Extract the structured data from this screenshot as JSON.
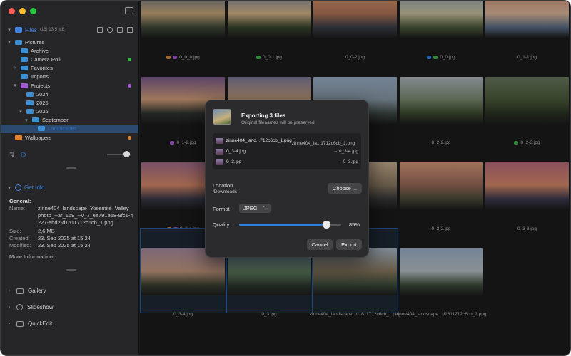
{
  "sidebar": {
    "files_title": "Files",
    "files_meta": "(16) 13,5 MB",
    "tree": [
      {
        "label": "Pictures",
        "level": 0,
        "chevron": "▾",
        "color": "#3d8fd4"
      },
      {
        "label": "Archive",
        "level": 1,
        "chevron": "",
        "color": "#3d8fd4"
      },
      {
        "label": "Camera Roll",
        "level": 1,
        "chevron": "",
        "color": "#3d8fd4",
        "dot": "#3ab54a"
      },
      {
        "label": "Favorites",
        "level": 1,
        "chevron": "›",
        "color": "#3d8fd4"
      },
      {
        "label": "Imports",
        "level": 1,
        "chevron": "",
        "color": "#3d8fd4"
      },
      {
        "label": "Projects",
        "level": 1,
        "chevron": "▾",
        "color": "#a45bd6",
        "dot": "#a45bd6"
      },
      {
        "label": "2024",
        "level": 2,
        "chevron": "",
        "color": "#3d8fd4"
      },
      {
        "label": "2025",
        "level": 2,
        "chevron": "",
        "color": "#3d8fd4"
      },
      {
        "label": "2026",
        "level": 2,
        "chevron": "▾",
        "color": "#3d8fd4"
      },
      {
        "label": "September",
        "level": 3,
        "chevron": "▾",
        "color": "#3d8fd4"
      },
      {
        "label": "Landscapes",
        "level": 4,
        "chevron": "",
        "color": "#3d8fd4",
        "selected": true
      },
      {
        "label": "Wallpapers",
        "level": 0,
        "chevron": "",
        "color": "#e0842f",
        "dot": "#e0842f"
      }
    ],
    "info_title": "Get Info",
    "info_section": "General:",
    "info": {
      "name_label": "Name:",
      "name_value": "zinne404_landscape_Yosemite_Valley_photo_--ar_169_--v_7_6a791e58-9fc1-4227-abd2-d1611712c6cb_1.png",
      "size_label": "Size:",
      "size_value": "2,6 MB",
      "created_label": "Created:",
      "created_value": "23. Sep 2025 at 15:24",
      "modified_label": "Modified:",
      "modified_value": "23. Sep 2025 at 15:24",
      "more": "More Information:"
    },
    "panels": [
      "Gallery",
      "Slideshow",
      "QuickEdit"
    ]
  },
  "grid": {
    "items": [
      {
        "caption": "0_0_0.jpg",
        "tag": "#d98a3c",
        "tag2": "#a45bd6",
        "colors": [
          "#5b6e8a",
          "#c9a77a",
          "#3f4a3a"
        ]
      },
      {
        "caption": "0_0-1.jpg",
        "tag": "#3ab54a",
        "colors": [
          "#6b7fa0",
          "#d8b68a",
          "#39452e"
        ]
      },
      {
        "caption": "0_0-2.jpg",
        "colors": [
          "#e0a070",
          "#b27458",
          "#3a3f48"
        ]
      },
      {
        "caption": "0_0.jpg",
        "tag": "#2f7fe0",
        "tag2": "#3ab54a",
        "colors": [
          "#8aa0b8",
          "#c9c3a0",
          "#4b5a3a"
        ]
      },
      {
        "caption": "0_1-1.jpg",
        "colors": [
          "#c88c7a",
          "#e0b89a",
          "#5a6e88"
        ]
      },
      {
        "caption": "0_1-2.jpg",
        "tag": "#a45bd6",
        "colors": [
          "#7a5a8e",
          "#d4a07a",
          "#2f3430"
        ]
      },
      {
        "caption": "",
        "colors": [
          "#7b7a9a",
          "#c9a27e",
          "#3d4436"
        ]
      },
      {
        "caption": "",
        "colors": [
          "#9ab0c8",
          "#8a9aa8",
          "#3e4a44"
        ]
      },
      {
        "caption": "0_2-2.jpg",
        "colors": [
          "#b0b8c0",
          "#7a8a70",
          "#3c4a2e"
        ]
      },
      {
        "caption": "0_2-3.jpg",
        "tag": "#3ab54a",
        "colors": [
          "#6a7a60",
          "#4b5a38",
          "#2a3324"
        ]
      },
      {
        "caption": "0_2-4.jpg",
        "tag": "#d98a3c",
        "tag2": "#a45bd6",
        "colors": [
          "#a06a8a",
          "#d88a6a",
          "#3a3a4a"
        ]
      },
      {
        "caption": "",
        "colors": [
          "#e0a27a",
          "#b07a60",
          "#3a3a3c"
        ]
      },
      {
        "caption": "",
        "colors": [
          "#c8b090",
          "#8a7860",
          "#3a3a3c"
        ]
      },
      {
        "caption": "0_3-2.jpg",
        "colors": [
          "#d49a7a",
          "#9a6a5a",
          "#4a4a3a"
        ]
      },
      {
        "caption": "0_3-3.jpg",
        "colors": [
          "#b86a7a",
          "#d88a6a",
          "#3e3a50"
        ]
      },
      {
        "caption": "0_3-4.jpg",
        "selected": true,
        "colors": [
          "#a88aa0",
          "#c49a80",
          "#3a4030"
        ]
      },
      {
        "caption": "0_3.jpg",
        "selected": true,
        "colors": [
          "#8aa6c8",
          "#6a8a6a",
          "#2e3a2e"
        ]
      },
      {
        "caption": "zinne404_landscape...d1611712c6cb_1.png",
        "selected": true,
        "colors": [
          "#aab8c8",
          "#8a7a60",
          "#3a4a3a"
        ]
      },
      {
        "caption": "zinne404_landscape...d1611712c6cb_2.png",
        "colors": [
          "#9ab0c8",
          "#b8c0c4",
          "#3e4a3a"
        ]
      }
    ]
  },
  "dialog": {
    "title": "Exporting 3 files",
    "subtitle": "Original filenames will be preserved",
    "files": [
      {
        "name": "zinne404_land...712c6cb_1.png",
        "dest": "→ zinne404_la...1712c6cb_1.png"
      },
      {
        "name": "0_3-4.jpg",
        "dest": "→ 0_3-4.jpg"
      },
      {
        "name": "0_3.jpg",
        "dest": "→ 0_3.jpg"
      }
    ],
    "location_label": "Location",
    "location_path": "/Downloads",
    "choose_label": "Choose ...",
    "format_label": "Format",
    "format_value": "JPEG",
    "format_chevron": "⌃⌄",
    "quality_label": "Quality",
    "quality_value": "85%",
    "quality_fraction": 0.85,
    "cancel_label": "Cancel",
    "export_label": "Export"
  }
}
